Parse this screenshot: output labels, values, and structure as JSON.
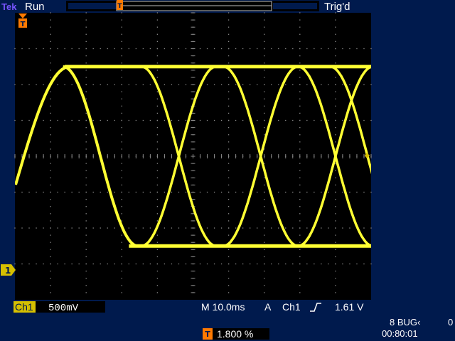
{
  "scope": {
    "brand": "Tek",
    "run_state": "Run",
    "trigger_status": "Trig'd",
    "channel_label": "Ch1",
    "volts_per_div": "500mV",
    "timebase": "M 10.0ms",
    "trigger_source_prefix": "A",
    "trigger_source": "Ch1",
    "trigger_level": "1.61 V",
    "trigger_position": "1.800 %",
    "date": "8 BUG‹",
    "extra_digit": "0",
    "time": "00:80:01",
    "ch1_marker": "1",
    "trigger_marker": "T"
  },
  "colors": {
    "background_outer": "#001a4d",
    "screen": "#000000",
    "grid": "#8a8a8a",
    "trace": "#ffff33",
    "ch1_label_bg": "#d6c000",
    "trigger_marker": "#ff7a00"
  },
  "chart_data": {
    "type": "line",
    "title": "",
    "xlabel": "",
    "ylabel": "",
    "x_divisions": 10,
    "y_divisions": 8,
    "time_per_div_ms": 10.0,
    "volts_per_div_V": 0.5,
    "series": [
      {
        "points_desc": "eye-pattern overlay: rising then falling transitions, crossings near 4.6, 6.9, 9.0 div",
        "crossings_div_x": [
          4.6,
          6.9,
          9.0
        ],
        "high_level_div": 2.5,
        "low_level_div": -2.5
      }
    ]
  }
}
